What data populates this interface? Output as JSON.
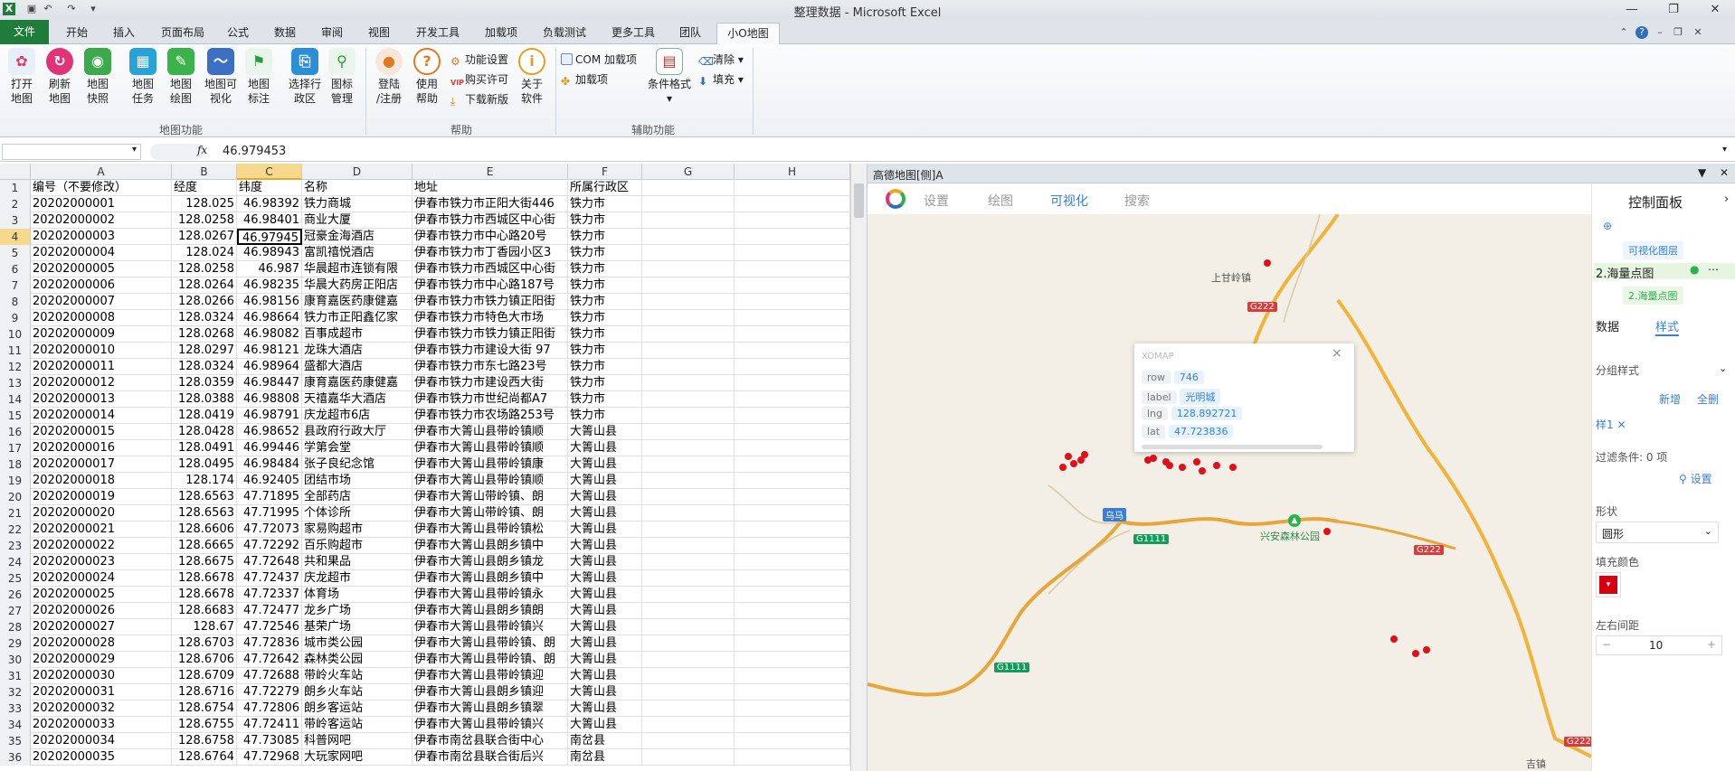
{
  "window": {
    "title": "整理数据 - Microsoft Excel"
  },
  "tabs": [
    "文件",
    "开始",
    "插入",
    "页面布局",
    "公式",
    "数据",
    "审阅",
    "视图",
    "开发工具",
    "加载项",
    "负载测试",
    "更多工具",
    "团队",
    "小O地图"
  ],
  "ribbon": {
    "map_buttons": [
      {
        "l1": "打开",
        "l2": "地图"
      },
      {
        "l1": "刷新",
        "l2": "地图"
      },
      {
        "l1": "地图",
        "l2": "快照"
      },
      {
        "l1": "地图",
        "l2": "任务"
      },
      {
        "l1": "地图",
        "l2": "绘图"
      },
      {
        "l1": "地图可",
        "l2": "视化"
      },
      {
        "l1": "地图",
        "l2": "标注"
      },
      {
        "l1": "选择行",
        "l2": "政区"
      },
      {
        "l1": "图标",
        "l2": "管理"
      }
    ],
    "help_buttons": [
      {
        "l1": "登陆",
        "l2": "/注册"
      },
      {
        "l1": "使用",
        "l2": "帮助"
      }
    ],
    "help_small": [
      "功能设置",
      "购买许可",
      "下载新版"
    ],
    "about": {
      "l1": "关于",
      "l2": "软件"
    },
    "aux_small": [
      "COM 加载项",
      "加载项"
    ],
    "cond_format": "条件格式",
    "clear": "清除",
    "fill": "填充",
    "groups": [
      "地图功能",
      "帮助",
      "辅助功能"
    ]
  },
  "formula_bar": {
    "fx": "fx",
    "value": "46.979453"
  },
  "columns": [
    "A",
    "B",
    "C",
    "D",
    "E",
    "F",
    "G",
    "H"
  ],
  "header_row": [
    "编号（不要修改）",
    "经度",
    "纬度",
    "名称",
    "地址",
    "所属行政区"
  ],
  "rows": [
    [
      "20202000001",
      "128.025",
      "46.98392",
      "铁力商城",
      "伊春市铁力市正阳大街446",
      "铁力市"
    ],
    [
      "20202000002",
      "128.0258",
      "46.98401",
      "商业大厦",
      "伊春市铁力市西城区中心街",
      "铁力市"
    ],
    [
      "20202000003",
      "128.0267",
      "46.97945",
      "冠豪金海酒店",
      "伊春市铁力市中心路20号",
      "铁力市"
    ],
    [
      "20202000004",
      "128.024",
      "46.98943",
      "富凯禧悦酒店",
      "伊春市铁力市丁香园小区3",
      "铁力市"
    ],
    [
      "20202000005",
      "128.0258",
      "46.987",
      "华晨超市连锁有限",
      "伊春市铁力市西城区中心街",
      "铁力市"
    ],
    [
      "20202000006",
      "128.0264",
      "46.98235",
      "华晨大药房正阳店",
      "伊春市铁力市中心路187号",
      "铁力市"
    ],
    [
      "20202000007",
      "128.0266",
      "46.98156",
      "康育嘉医药康健嘉",
      "伊春市铁力市铁力镇正阳街",
      "铁力市"
    ],
    [
      "20202000008",
      "128.0324",
      "46.98664",
      "铁力市正阳鑫亿家",
      "伊春市铁力市特色大市场",
      "铁力市"
    ],
    [
      "20202000009",
      "128.0268",
      "46.98082",
      "百事成超市",
      "伊春市铁力市铁力镇正阳街",
      "铁力市"
    ],
    [
      "20202000010",
      "128.0297",
      "46.98121",
      "龙珠大酒店",
      "伊春市铁力市建设大街 97",
      "铁力市"
    ],
    [
      "20202000011",
      "128.0324",
      "46.98964",
      "盛都大酒店",
      "伊春市铁力市东七路23号",
      "铁力市"
    ],
    [
      "20202000012",
      "128.0359",
      "46.98447",
      "康育嘉医药康健嘉",
      "伊春市铁力市建设西大街",
      "铁力市"
    ],
    [
      "20202000013",
      "128.0388",
      "46.98808",
      "天禧嘉华大酒店",
      "伊春市铁力市世纪尚都A7",
      "铁力市"
    ],
    [
      "20202000014",
      "128.0419",
      "46.98791",
      "庆龙超市6店",
      "伊春市铁力市农场路253号",
      "铁力市"
    ],
    [
      "20202000015",
      "128.0428",
      "46.98652",
      "县政府行政大厅",
      "伊春市大箐山县带岭镇顺",
      "大箐山县"
    ],
    [
      "20202000016",
      "128.0491",
      "46.99446",
      "学第会堂",
      "伊春市大箐山县带岭镇顺",
      "大箐山县"
    ],
    [
      "20202000017",
      "128.0495",
      "46.98484",
      "张子良纪念馆",
      "伊春市大箐山县带岭镇康",
      "大箐山县"
    ],
    [
      "20202000018",
      "128.174",
      "46.92405",
      "团结市场",
      "伊春市大箐山县带岭镇顺",
      "大箐山县"
    ],
    [
      "20202000019",
      "128.6563",
      "47.71895",
      "全部药店",
      "伊春市大箐山带岭镇、朗",
      "大箐山县"
    ],
    [
      "20202000020",
      "128.6563",
      "47.71995",
      "个体诊所",
      "伊春市大箐山带岭镇、朗",
      "大箐山县"
    ],
    [
      "20202000021",
      "128.6606",
      "47.72073",
      "家易购超市",
      "伊春市大箐山县带岭镇松",
      "大箐山县"
    ],
    [
      "20202000022",
      "128.6665",
      "47.72292",
      "百乐购超市",
      "伊春市大箐山县朗乡镇中",
      "大箐山县"
    ],
    [
      "20202000023",
      "128.6675",
      "47.72648",
      "共和果品",
      "伊春市大箐山县朗乡镇龙",
      "大箐山县"
    ],
    [
      "20202000024",
      "128.6678",
      "47.72437",
      "庆龙超市",
      "伊春市大箐山县朗乡镇中",
      "大箐山县"
    ],
    [
      "20202000025",
      "128.6678",
      "47.72337",
      "体育场",
      "伊春市大箐山县带岭镇永",
      "大箐山县"
    ],
    [
      "20202000026",
      "128.6683",
      "47.72477",
      "龙乡广场",
      "伊春市大箐山县朗乡镇朗",
      "大箐山县"
    ],
    [
      "20202000027",
      "128.67",
      "47.72546",
      "基荣广场",
      "伊春市大箐山县带岭镇兴",
      "大箐山县"
    ],
    [
      "20202000028",
      "128.6703",
      "47.72836",
      "城市类公园",
      "伊春市大箐山县带岭镇、朗",
      "大箐山县"
    ],
    [
      "20202000029",
      "128.6706",
      "47.72642",
      "森林类公园",
      "伊春市大箐山县带岭镇、朗",
      "大箐山县"
    ],
    [
      "20202000030",
      "128.6709",
      "47.72688",
      "带岭火车站",
      "伊春市大箐山县带岭镇迎",
      "大箐山县"
    ],
    [
      "20202000031",
      "128.6716",
      "47.72279",
      "朗乡火车站",
      "伊春市大箐山县朗乡镇迎",
      "大箐山县"
    ],
    [
      "20202000032",
      "128.6754",
      "47.72806",
      "朗乡客运站",
      "伊春市大箐山县朗乡镇翠",
      "大箐山县"
    ],
    [
      "20202000033",
      "128.6755",
      "47.72411",
      "带岭客运站",
      "伊春市大箐山县带岭镇兴",
      "大箐山县"
    ],
    [
      "20202000034",
      "128.6758",
      "47.73085",
      "科普网吧",
      "伊春市南岔县联合街中心",
      "南岔县"
    ],
    [
      "20202000035",
      "128.6764",
      "47.72968",
      "大玩家网吧",
      "伊春市南岔县联合街后兴",
      "南岔县"
    ]
  ],
  "map_panel": {
    "title": "高德地图[侧]A",
    "toolbar": [
      "设置",
      "绘图",
      "可视化",
      "搜索"
    ],
    "road_labels": [
      "G222",
      "G222",
      "G1111",
      "G1111",
      "G222"
    ],
    "place_labels": [
      "上甘岭镇",
      "兴安森林公园",
      "乌马",
      "吉镇"
    ],
    "popup": {
      "header": "XOMAP",
      "fields": [
        {
          "k": "row",
          "v": "746"
        },
        {
          "k": "label",
          "v": "光明城"
        },
        {
          "k": "lng",
          "v": "128.892721"
        },
        {
          "k": "lat",
          "v": "47.723836"
        }
      ]
    }
  },
  "control_panel": {
    "title": "控制面板",
    "vis_layer": "可视化图层",
    "layer_name": "2.海量点图",
    "layer_tag": "2.海量点图",
    "tabs": [
      "数据",
      "样式"
    ],
    "group_style": "分组样式",
    "new": "新增",
    "delete_all": "全删",
    "style_tag": "样1",
    "filter": "过滤条件: 0 项",
    "settings": "设置",
    "shape_label": "形状",
    "shape_value": "圆形",
    "fill_label": "填充颜色",
    "fill_color": "#d7000f",
    "spacing_label": "左右间距",
    "spacing_value": "10"
  }
}
